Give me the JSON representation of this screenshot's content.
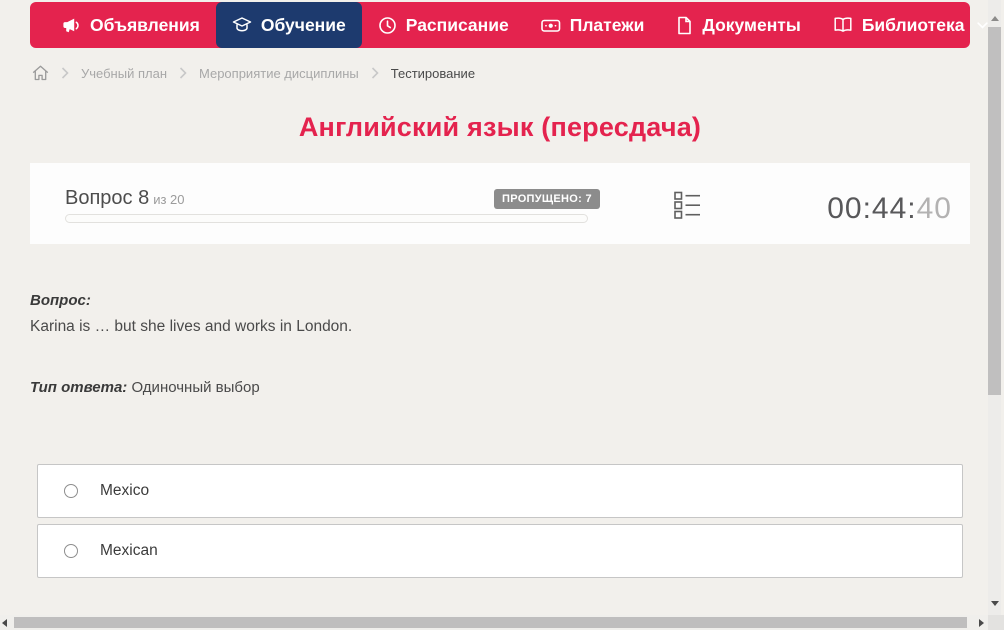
{
  "colors": {
    "accent_red": "#e4234e",
    "nav_active_navy": "#1d3a6e",
    "badge_gray": "#8c8c8c",
    "page_background": "#f2f0ec"
  },
  "nav": {
    "items": [
      {
        "label": "Объявления",
        "icon": "megaphone-icon",
        "active": false
      },
      {
        "label": "Обучение",
        "icon": "graduation-cap-icon",
        "active": true
      },
      {
        "label": "Расписание",
        "icon": "clock-icon",
        "active": false
      },
      {
        "label": "Платежи",
        "icon": "banknote-icon",
        "active": false
      },
      {
        "label": "Документы",
        "icon": "document-icon",
        "active": false
      },
      {
        "label": "Библиотека",
        "icon": "open-book-icon",
        "dropdown_icon": "chevron-down-icon",
        "active": false
      }
    ]
  },
  "breadcrumb": {
    "home_icon": "home-icon",
    "items": [
      {
        "label": "Учебный план",
        "current": false
      },
      {
        "label": "Мероприятие дисциплины",
        "current": false
      },
      {
        "label": "Тестирование",
        "current": true
      }
    ]
  },
  "page": {
    "title": "Английский язык (пересдача)"
  },
  "question_panel": {
    "question_number": "Вопрос 8",
    "question_of": "из 20",
    "skipped_badge": "ПРОПУЩЕНО: 7",
    "progress_percent": 0,
    "question_list_icon": "question-list-icon",
    "timer": {
      "hours_minutes": "00:44:",
      "seconds": "40"
    }
  },
  "question": {
    "prompt_label": "Вопрос:",
    "prompt_text": "Karina is … but she lives and works in London.",
    "answer_type_label": "Тип ответа:",
    "answer_type_value": "Одиночный выбор"
  },
  "answers": [
    {
      "label": "Mexico",
      "selected": false
    },
    {
      "label": "Mexican",
      "selected": false
    }
  ]
}
